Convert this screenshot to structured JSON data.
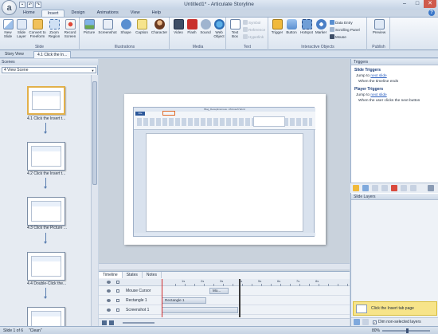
{
  "window": {
    "title": "Untitled1* - Articulate Storyline",
    "controls": [
      "–",
      "□",
      "✕"
    ]
  },
  "ribbon": {
    "tabs": [
      "Home",
      "Insert",
      "Design",
      "Animations",
      "View",
      "Help"
    ],
    "active_tab": "Insert",
    "groups": {
      "slide": {
        "label": "Slide",
        "buttons": [
          "New Slide",
          "Slide Layer",
          "Convert to Freeform",
          "Zoom Region",
          "Record Screen"
        ]
      },
      "illustrations": {
        "label": "Illustrations",
        "buttons": [
          "Picture",
          "Screenshot",
          "Shape",
          "Caption",
          "Character"
        ]
      },
      "media": {
        "label": "Media",
        "buttons": [
          "Video",
          "Flash",
          "Sound",
          "Web Object"
        ]
      },
      "text": {
        "label": "Text",
        "buttons": [
          "Text Box"
        ],
        "small": [
          "Symbol",
          "Reference",
          "Hyperlink"
        ]
      },
      "interactive": {
        "label": "Interactive Objects",
        "buttons": [
          "Trigger",
          "Button",
          "Hotspot",
          "Marker"
        ],
        "small": [
          "Data Entry",
          "Scrolling Panel",
          "Mouse"
        ]
      },
      "publish": {
        "label": "Publish",
        "buttons": [
          "Preview"
        ]
      }
    }
  },
  "doc_tabs": [
    "Story View",
    "4.1 Click the In..."
  ],
  "scenes": {
    "header": "Scenes",
    "selected_scene": "4 View Scene",
    "slides": [
      {
        "caption": "4.1 Click the Insert t...",
        "selected": true
      },
      {
        "caption": "4.2 Click the Insert t...",
        "selected": false
      },
      {
        "caption": "4.3 Click the Picture ...",
        "selected": false
      },
      {
        "caption": "4.4 Double-Click the...",
        "selected": false
      },
      {
        "caption": "",
        "selected": false
      }
    ]
  },
  "word_screenshot": {
    "title": "Blog_Deceptinomous - Microsoft Word",
    "file_tab": "File"
  },
  "timeline": {
    "tabs": [
      "Timeline",
      "States",
      "Notes"
    ],
    "active_tab": "Timeline",
    "ruler": [
      "1s",
      "2s",
      "3s",
      "4s",
      "5s",
      "6s",
      "7s",
      "8s"
    ],
    "rows": [
      {
        "name": "Mouse Cursor",
        "bar": "Mo..."
      },
      {
        "name": "Rectangle 1",
        "bar": "Rectangle 1"
      },
      {
        "name": "Screenshot 1",
        "bar": ""
      }
    ]
  },
  "triggers": {
    "header": "Triggers",
    "slide_title": "Slide Triggers",
    "slide_action": "Jump to",
    "slide_link": "next slide",
    "slide_when": "When the timeline ends",
    "player_title": "Player Triggers",
    "player_action": "Jump to",
    "player_link": "next slide",
    "player_when": "When the user clicks the next button"
  },
  "layers": {
    "header": "Slide Layers",
    "base_layer": "Click the Insert tab page",
    "dim_label": "Dim non-selected layers",
    "dim_checked": "✓"
  },
  "status": {
    "slide": "Slide 1 of 6",
    "theme": "\"Clean\"",
    "zoom": "80%"
  }
}
